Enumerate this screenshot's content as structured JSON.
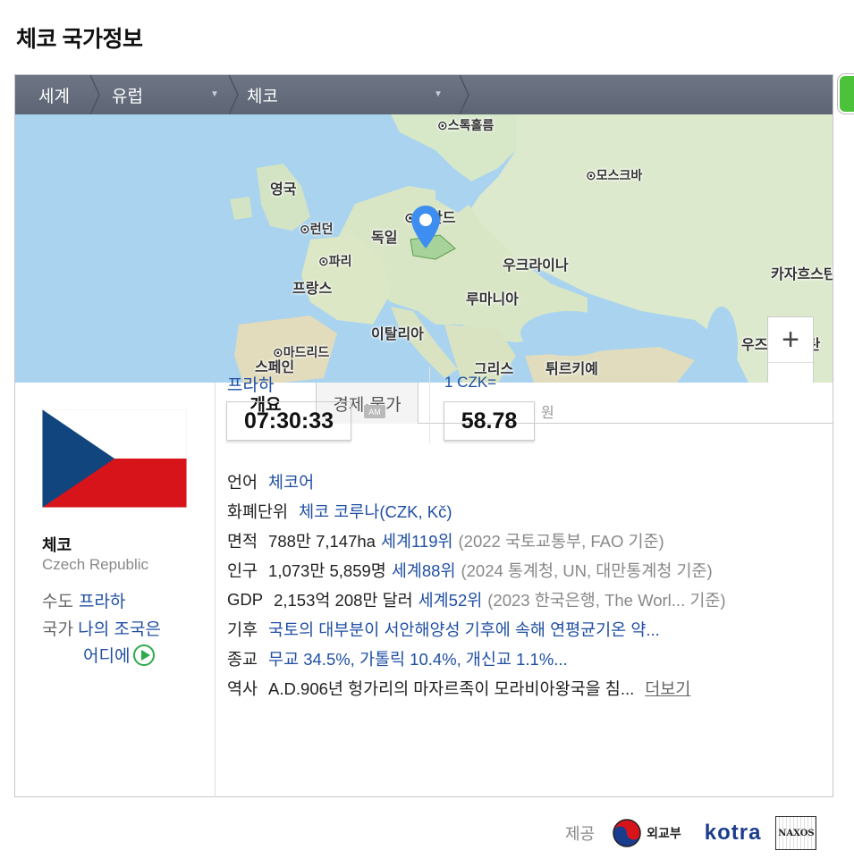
{
  "page": {
    "title": "체코 국가정보"
  },
  "breadcrumb": {
    "world": "세계",
    "region": "유럽",
    "country": "체코"
  },
  "map": {
    "labels": {
      "stockholm": "⊙스톡홀름",
      "moscow": "⊙모스크바",
      "uk": "영국",
      "london": "⊙런던",
      "germany": "독일",
      "poland": "⊙폴란드",
      "paris": "⊙파리",
      "france": "프랑스",
      "ukraine": "우크라이나",
      "kazakhstan": "카자흐스탄",
      "romania": "루마니아",
      "italy": "이탈리아",
      "madrid": "⊙마드리드",
      "spain": "스페인",
      "greece": "그리스",
      "turkey": "튀르키예",
      "uzbekistan": "우즈베키스탄"
    },
    "zoom_in": "+",
    "zoom_out": "—"
  },
  "country": {
    "name_ko": "체코",
    "name_en": "Czech Republic",
    "capital_label": "수도",
    "capital": "프라하",
    "anthem_label": "국가",
    "anthem_line1": "나의 조국은",
    "anthem_line2": "어디에"
  },
  "tabs": {
    "overview": "개요",
    "economy": "경제·물가"
  },
  "time": {
    "city": "프라하",
    "clock": "07:30:33",
    "ampm": "AM"
  },
  "exchange": {
    "label": "1 CZK=",
    "value": "58.78",
    "unit": "원"
  },
  "info": {
    "language": {
      "key": "언어",
      "value": "체코어"
    },
    "currency": {
      "key": "화폐단위",
      "value": "체코 코루나(CZK, Kč)"
    },
    "area": {
      "key": "면적",
      "value": "788만 7,147ha",
      "rank": "세계119위",
      "source": "(2022 국토교통부, FAO 기준)"
    },
    "population": {
      "key": "인구",
      "value": "1,073만 5,859명",
      "rank": "세계88위",
      "source": "(2024 통계청, UN, 대만통계청 기준)"
    },
    "gdp": {
      "key": "GDP",
      "value": "2,153억 208만 달러",
      "rank": "세계52위",
      "source": "(2023 한국은행, The Worl...  기준)"
    },
    "climate": {
      "key": "기후",
      "value": "국토의 대부분이 서안해양성 기후에 속해 연평균기온 약..."
    },
    "religion": {
      "key": "종교",
      "value": "무교 34.5%, 가톨릭 10.4%, 개신교 1.1%..."
    },
    "history": {
      "key": "역사",
      "value": "A.D.906년 헝가리의 마자르족이 모라비아왕국을 침...",
      "more": "더보기"
    }
  },
  "provider": {
    "label": "제공",
    "mofa": "외교부",
    "kotra": "kotra",
    "naxos": "NAXOS"
  },
  "colors": {
    "link": "#1f4fa3",
    "breadcrumb_bg": "#636b7a",
    "play": "#2ea94b",
    "pin": "#3d8ef0"
  }
}
